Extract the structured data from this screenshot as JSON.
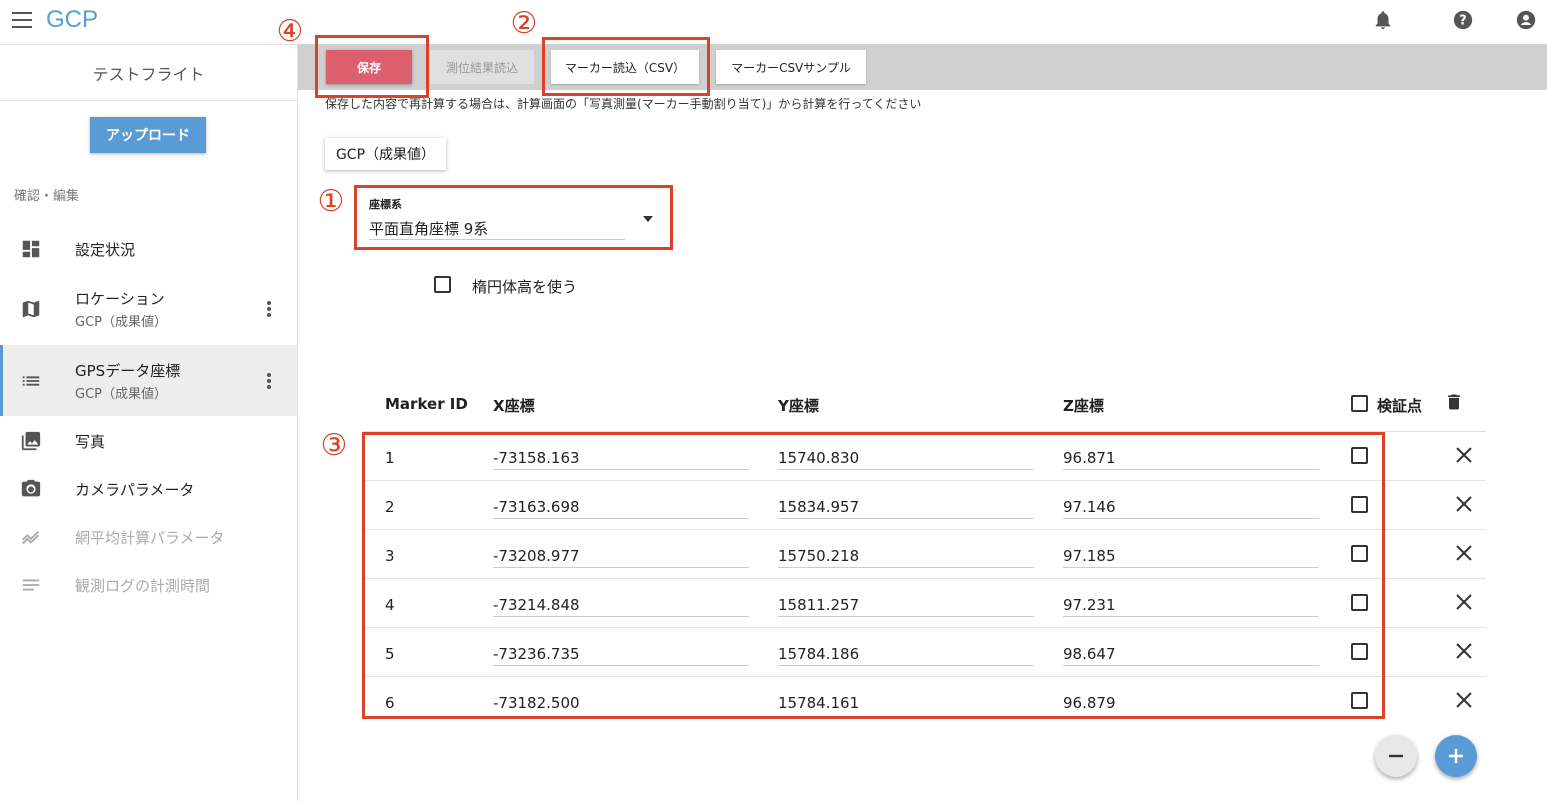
{
  "app": {
    "title": "GCP"
  },
  "sidebar": {
    "flight_name": "テストフライト",
    "upload_label": "アップロード",
    "section_label": "確認・編集",
    "items": [
      {
        "label": "設定状況",
        "sub": "",
        "icon": "dashboard-icon",
        "state": "normal"
      },
      {
        "label": "ロケーション",
        "sub": "GCP（成果値）",
        "icon": "map-icon",
        "state": "normal"
      },
      {
        "label": "GPSデータ座標",
        "sub": "GCP（成果値）",
        "icon": "list-icon",
        "state": "active"
      },
      {
        "label": "写真",
        "sub": "",
        "icon": "photo-library-icon",
        "state": "normal"
      },
      {
        "label": "カメラパラメータ",
        "sub": "",
        "icon": "camera-icon",
        "state": "normal"
      },
      {
        "label": "網平均計算パラメータ",
        "sub": "",
        "icon": "trend-icon",
        "state": "disabled"
      },
      {
        "label": "観測ログの計測時間",
        "sub": "",
        "icon": "notes-icon",
        "state": "disabled"
      }
    ]
  },
  "toolbar": {
    "save_label": "保存",
    "survey_label": "測位結果読込",
    "marker_csv_label": "マーカー読込（CSV）",
    "sample_label": "マーカーCSVサンプル"
  },
  "notice": "保存した内容で再計算する場合は、計算画面の「写真測量(マーカー手動割り当て)」から計算を行ってください",
  "tab_label": "GCP（成果値）",
  "coordinate_system": {
    "label": "座標系",
    "value": "平面直角座標 9系"
  },
  "ellipsoid_label": "楕円体高を使う",
  "table": {
    "headers": {
      "id": "Marker ID",
      "x": "X座標",
      "y": "Y座標",
      "z": "Z座標",
      "verify": "検証点"
    },
    "rows": [
      {
        "id": "1",
        "x": "-73158.163",
        "y": "15740.830",
        "z": "96.871"
      },
      {
        "id": "2",
        "x": "-73163.698",
        "y": "15834.957",
        "z": "97.146"
      },
      {
        "id": "3",
        "x": "-73208.977",
        "y": "15750.218",
        "z": "97.185"
      },
      {
        "id": "4",
        "x": "-73214.848",
        "y": "15811.257",
        "z": "97.231"
      },
      {
        "id": "5",
        "x": "-73236.735",
        "y": "15784.186",
        "z": "98.647"
      },
      {
        "id": "6",
        "x": "-73182.500",
        "y": "15784.161",
        "z": "96.879"
      }
    ]
  },
  "annotations": [
    "①",
    "②",
    "③",
    "④"
  ],
  "colors": {
    "accent": "#5b9bd5",
    "save": "#dc5f6e",
    "annotation": "#d9432a",
    "toolbar": "#d0d0d0"
  }
}
